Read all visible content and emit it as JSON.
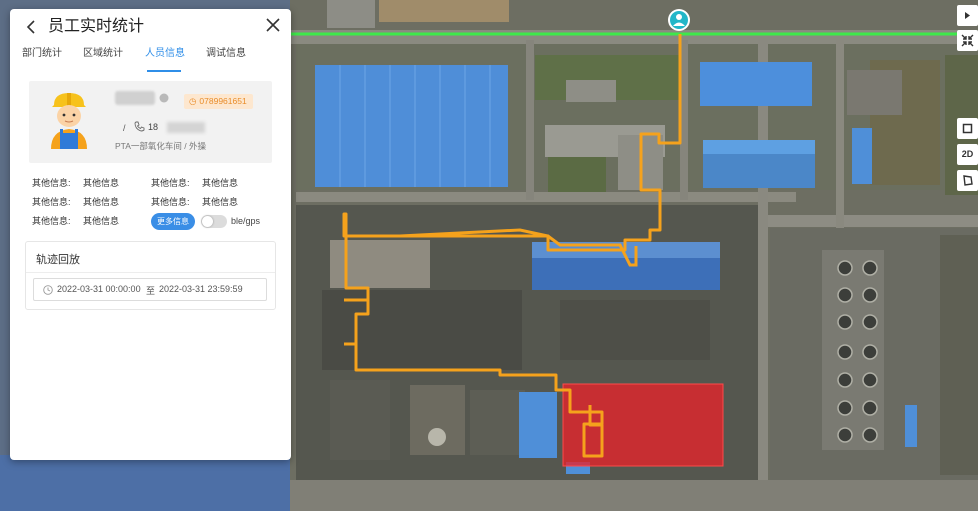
{
  "panel": {
    "title": "员工实时统计",
    "tabs": [
      {
        "label": "部门统计",
        "active": false
      },
      {
        "label": "区域统计",
        "active": false
      },
      {
        "label": "人员信息",
        "active": true
      },
      {
        "label": "调试信息",
        "active": false
      }
    ],
    "person": {
      "phone_badge": "0789961651",
      "slash": "/",
      "phone_prefix": "18",
      "department": "PTA一部氧化车间 / 外操"
    },
    "info_rows": [
      [
        "其他信息:",
        "其他信息",
        "其他信息:",
        "其他信息"
      ],
      [
        "其他信息:",
        "其他信息",
        "其他信息:",
        "其他信息"
      ],
      [
        "其他信息:",
        "其他信息"
      ]
    ],
    "more_button": "更多信息",
    "toggle_label": "ble/gps",
    "track": {
      "title": "轨迹回放",
      "start": "2022-03-31 00:00:00",
      "separator": "至",
      "end": "2022-03-31 23:59:59"
    }
  },
  "toolbar": {
    "mode_2d": "2D"
  },
  "colors": {
    "accent": "#2f8ee8",
    "track_line": "#f5a21c",
    "alert_zone": "#e8232a",
    "fence_line": "#3ee84a"
  }
}
